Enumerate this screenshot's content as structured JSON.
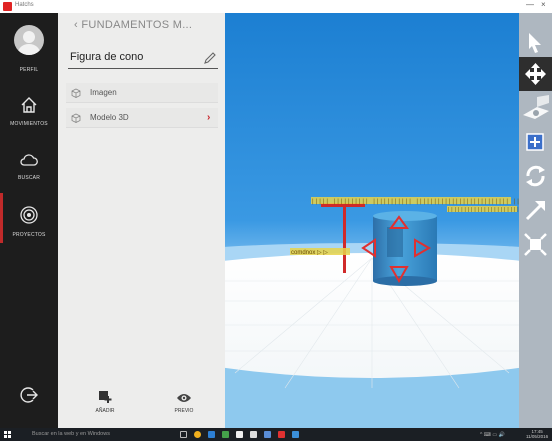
{
  "window": {
    "app_title": "Hatchs"
  },
  "rail": {
    "profile_label": "PERFIL",
    "items": [
      {
        "label": "MOVIMIENTOS"
      },
      {
        "label": "BUSCAR"
      },
      {
        "label": "PROYECTOS"
      }
    ]
  },
  "panel": {
    "breadcrumb": "FUNDAMENTOS M...",
    "project_name": "Figura de cono",
    "items": [
      {
        "label": "Imagen"
      },
      {
        "label": "Modelo 3D"
      }
    ],
    "add_label": "AÑADIR",
    "preview_label": "PREVIO"
  },
  "viewport": {
    "text_side": "comdnox ▷ ▷",
    "text_top_left": "||||| |||||||||| ||||||||||| |||||||||||||||||||||||||| |||||||||",
    "text_top_right": "|||||||||||||||||||||||||||"
  },
  "toolbar": {
    "tools": [
      "select-arrow",
      "move",
      "plane",
      "snap",
      "rotate",
      "scale-arrow",
      "fit"
    ]
  },
  "taskbar": {
    "search_placeholder": "Buscar en la web y en Windows",
    "clock_time": "17:45",
    "clock_date": "11/05/2016"
  },
  "colors": {
    "accent": "#c8242a",
    "rail": "#1d1d1d",
    "panel": "#ededec",
    "toolbar": "#aeb7c0",
    "sky": "#2f8fd8",
    "cylinder": "#3a8fc9"
  }
}
